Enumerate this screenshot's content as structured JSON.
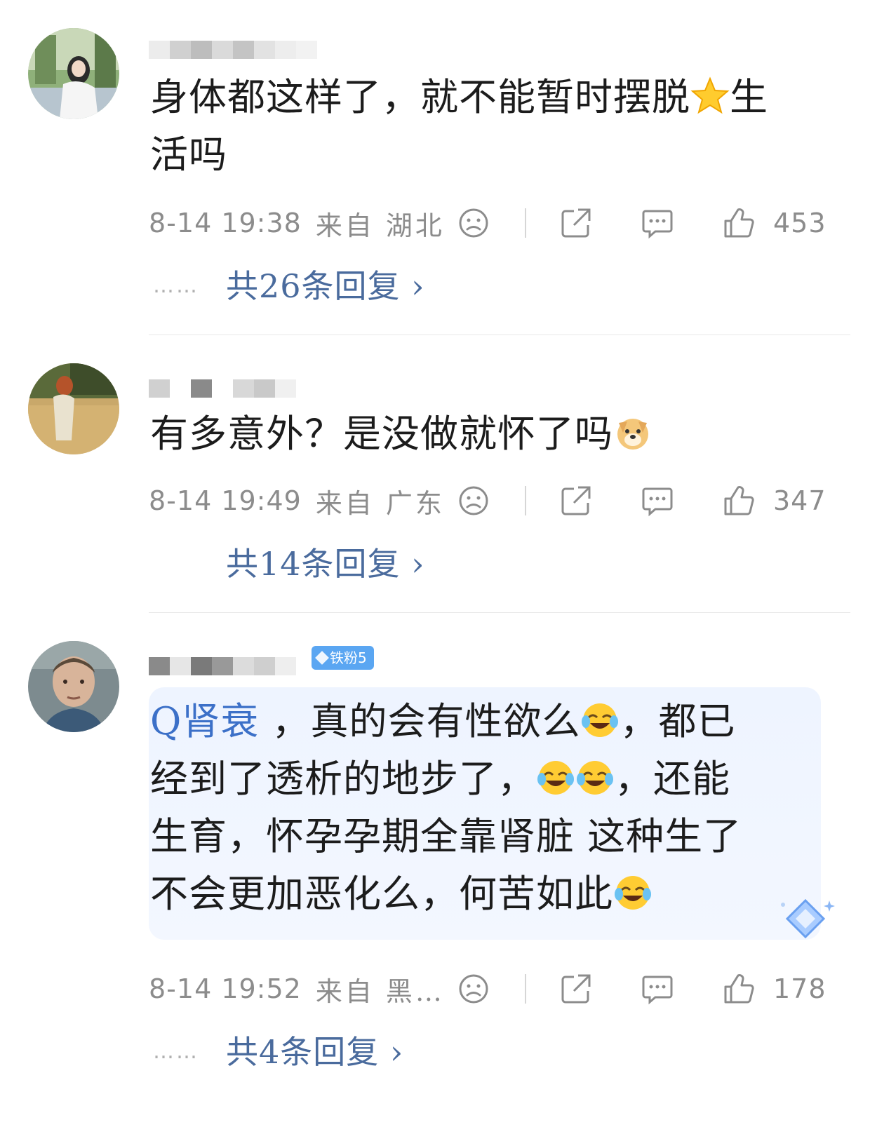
{
  "comments": [
    {
      "text_line1": "身体都这样了，就不能暂时摆脱",
      "text_after_emoji": "生",
      "text_line2": "活吗",
      "time": "8-14 19:38",
      "from": "来自 湖北",
      "likes": "453",
      "replies": "共26条回复 ›",
      "show_dots": "……"
    },
    {
      "text": "有多意外？是没做就怀了吗",
      "time": "8-14 19:49",
      "from": "来自 广东",
      "likes": "347",
      "replies": "共14条回复 ›"
    },
    {
      "badge": "铁粉5",
      "search_link": "Q肾衰",
      "text_a": " ，真的会有性欲么",
      "text_b": "，都已",
      "text_line2a": "经到了透析的地步了，",
      "text_line2b": "，还能",
      "text_line3": "生育，怀孕孕期全靠肾脏 这种生了",
      "text_line4": "不会更加恶化么，何苦如此",
      "time": "8-14 19:52",
      "from": "来自 黑…",
      "likes": "178",
      "replies": "共4条回复 ›",
      "show_dots": "……"
    }
  ],
  "icons": [
    "sad-face-icon",
    "share-icon",
    "comment-icon",
    "thumbs-up-icon"
  ],
  "colors": {
    "link": "#4a6b9d",
    "meta": "#8c8c8c",
    "badge": "#5aa6f2"
  }
}
